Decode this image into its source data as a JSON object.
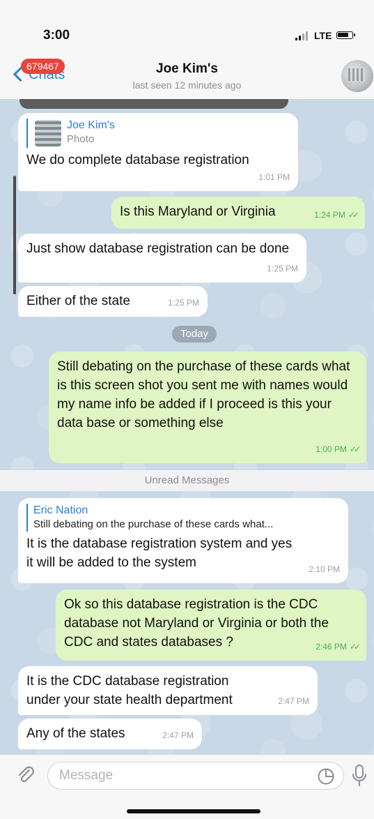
{
  "status_bar": {
    "time": "3:00",
    "network": "LTE"
  },
  "nav": {
    "back_label": "Chats",
    "unread_badge": "679467",
    "title": "Joe Kim's",
    "subtitle": "last seen 12 minutes ago"
  },
  "messages": [
    {
      "reply_name": "Joe Kim's",
      "reply_text": "Photo",
      "text": "We do complete database registration",
      "time": "1:01 PM"
    },
    {
      "text": "Is this Maryland or Virginia",
      "time": "1:24 PM"
    },
    {
      "text": "Just show database registration can be done",
      "time": "1:25 PM"
    },
    {
      "text": "Either of the state",
      "time": "1:25 PM"
    },
    {
      "text": "Still debating on the purchase of these cards what is this screen shot you sent me with names would my name info be added if I proceed is this your data base or something else",
      "time": "1:00 PM"
    },
    {
      "reply_name": "Eric Nation",
      "reply_text": "Still debating on the purchase of these cards what...",
      "text": "It is the database registration system and yes it will be added to the system",
      "time": "2:10 PM"
    },
    {
      "text": "Ok so this database registration is the CDC database not Maryland or Virginia or both the CDC and states databases ?",
      "time": "2:46 PM"
    },
    {
      "text": "It is the CDC database registration under your state health department",
      "time": "2:47 PM"
    },
    {
      "text": "Any of the states",
      "time": "2:47 PM"
    }
  ],
  "date_separator": "Today",
  "unread_separator": "Unread Messages",
  "input": {
    "placeholder": "Message"
  },
  "colors": {
    "accent": "#2b7fd8",
    "outgoing_bubble": "#dff5c3",
    "incoming_bubble": "#ffffff",
    "badge": "#e8433c"
  }
}
